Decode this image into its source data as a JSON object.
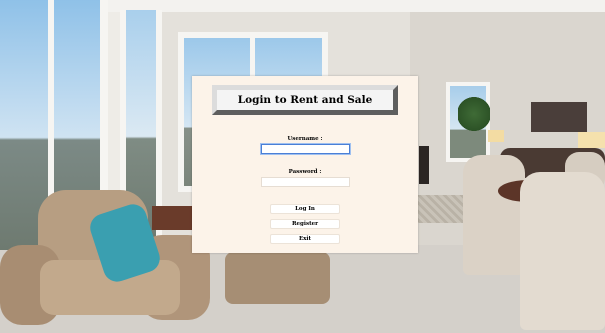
{
  "dialog": {
    "title": "Login to Rent and Sale",
    "username_label": "Username :",
    "username_value": "",
    "password_label": "Password :",
    "password_value": "",
    "buttons": {
      "login": "Log In",
      "register": "Register",
      "exit": "Exit"
    },
    "background_color": "#fcf3e9"
  },
  "background": {
    "description_icon": "living-room-photo"
  }
}
